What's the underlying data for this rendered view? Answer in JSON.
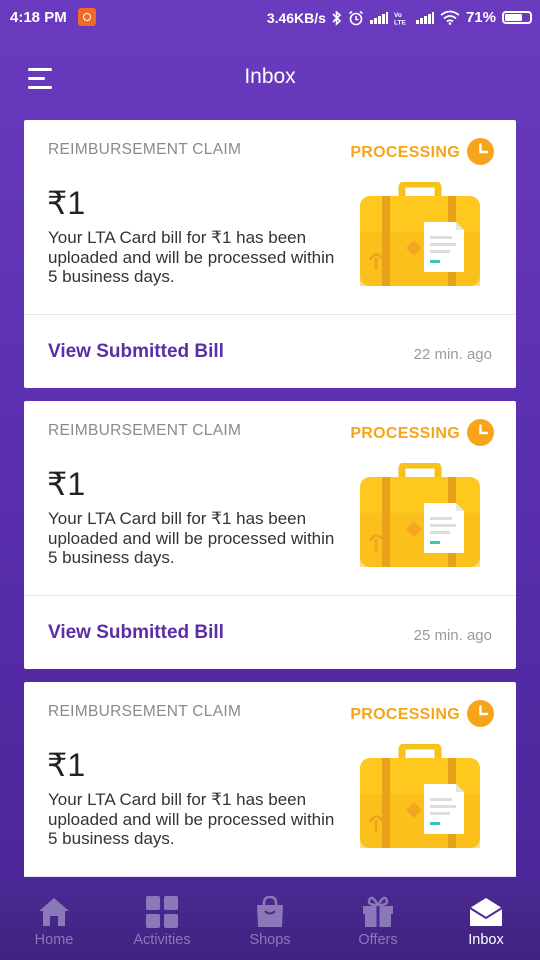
{
  "status_bar": {
    "time": "4:18 PM",
    "network_speed": "3.46KB/s",
    "battery": "71%",
    "icons": [
      "mi-notification-icon",
      "bluetooth-icon",
      "alarm-icon",
      "signal-icon",
      "volte-icon",
      "signal-icon",
      "wifi-icon",
      "battery-icon"
    ]
  },
  "header": {
    "title": "Inbox",
    "menu_icon": "menu-icon"
  },
  "cards": [
    {
      "category": "REIMBURSEMENT CLAIM",
      "status": "PROCESSING",
      "amount": "₹1",
      "description": "Your LTA Card bill for ₹1 has been uploaded and will be processed within 5 business days.",
      "link": "View Submitted Bill",
      "time_ago": "22 min. ago"
    },
    {
      "category": "REIMBURSEMENT CLAIM",
      "status": "PROCESSING",
      "amount": "₹1",
      "description": "Your LTA Card bill for ₹1 has been uploaded and will be processed within 5 business days.",
      "link": "View Submitted Bill",
      "time_ago": "25 min. ago"
    },
    {
      "category": "REIMBURSEMENT CLAIM",
      "status": "PROCESSING",
      "amount": "₹1",
      "description": "Your LTA Card bill for ₹1 has been uploaded and will be processed within 5 business days."
    }
  ],
  "nav": {
    "items": [
      {
        "label": "Home",
        "icon": "home-icon"
      },
      {
        "label": "Activities",
        "icon": "grid-icon"
      },
      {
        "label": "Shops",
        "icon": "shopping-bag-icon"
      },
      {
        "label": "Offers",
        "icon": "gift-icon"
      },
      {
        "label": "Inbox",
        "icon": "envelope-icon"
      }
    ],
    "active": "Inbox"
  },
  "colors": {
    "accent": "#5b2ea8",
    "processing": "#f6a51a",
    "header_bg": "#6a3bbf",
    "nav_bg": "#4b2a92"
  }
}
